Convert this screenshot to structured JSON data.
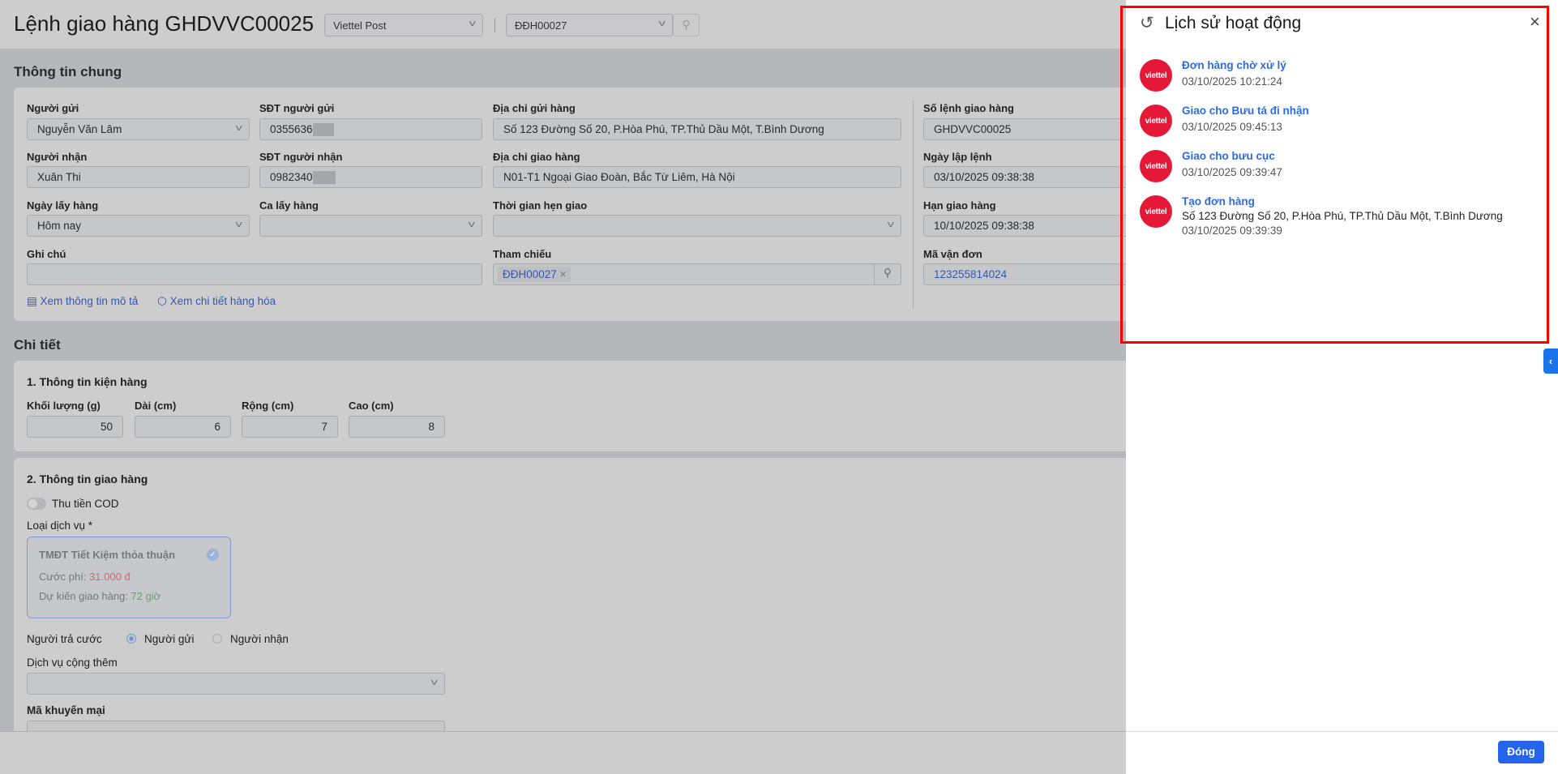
{
  "header": {
    "title": "Lệnh giao hàng GHDVVC00025",
    "carrier": "Viettel Post",
    "order": "ĐĐH00027"
  },
  "general": {
    "section_title": "Thông tin chung",
    "sender_label": "Người gửi",
    "sender": "Nguyễn Văn Lâm",
    "sender_phone_label": "SĐT người gửi",
    "sender_phone": "0355636",
    "pickup_addr_label": "Địa chỉ gửi hàng",
    "pickup_addr": "Số 123 Đường Số 20, P.Hòa Phú, TP.Thủ Dầu Một, T.Bình Dương",
    "receiver_label": "Người nhận",
    "receiver": "Xuân Thi",
    "receiver_phone_label": "SĐT người nhận",
    "receiver_phone": "0982340",
    "delivery_addr_label": "Địa chỉ giao hàng",
    "delivery_addr": "N01-T1 Ngoại Giao Đoàn, Bắc Từ Liêm, Hà Nội",
    "pickup_date_label": "Ngày lấy hàng",
    "pickup_date": "Hôm nay",
    "pickup_shift_label": "Ca lấy hàng",
    "appointment_label": "Thời gian hẹn giao",
    "note_label": "Ghi chú",
    "reference_label": "Tham chiếu",
    "reference_tag": "ĐĐH00027",
    "link_description": "Xem thông tin mô tả",
    "link_goods": "Xem chi tiết hàng hóa",
    "order_no_label": "Số lệnh giao hàng",
    "order_no": "GHDVVC00025",
    "created_label": "Ngày lập lệnh",
    "created": "03/10/2025 09:38:38",
    "deadline_label": "Hạn giao hàng",
    "deadline": "10/10/2025 09:38:38",
    "tracking_label": "Mã vận đơn",
    "tracking": "123255814024"
  },
  "detail": {
    "section_title": "Chi tiết",
    "package_title": "1. Thông tin kiện hàng",
    "weight_label": "Khối lượng (g)",
    "weight": "50",
    "length_label": "Dài (cm)",
    "length": "6",
    "width_label": "Rộng (cm)",
    "width": "7",
    "height_label": "Cao (cm)",
    "height": "8",
    "delivery_title": "2. Thông tin giao hàng",
    "cod_label": "Thu tiền COD",
    "service_label": "Loại dịch vụ *",
    "service_name": "TMĐT Tiết Kiệm thỏa thuận",
    "fee_label": "Cước phí: ",
    "fee": "31.000 đ",
    "eta_label": "Dự kiến giao hàng: ",
    "eta": "72 giờ",
    "payer_label": "Người trả cước",
    "payer_sender": "Người gửi",
    "payer_receiver": "Người nhận",
    "extra_label": "Dịch vụ cộng thêm",
    "promo_label": "Mã khuyến mại"
  },
  "history": {
    "title": "Lịch sử hoạt động",
    "avatar_text": "viettel",
    "items": [
      {
        "title": "Đơn hàng chờ xử lý",
        "time": "03/10/2025 10:21:24"
      },
      {
        "title": "Giao cho Bưu tá đi nhận",
        "time": "03/10/2025 09:45:13"
      },
      {
        "title": "Giao cho bưu cục",
        "time": "03/10/2025 09:39:47"
      },
      {
        "title": "Tạo đơn hàng",
        "address": "Số 123 Đường Số 20, P.Hòa Phú, TP.Thủ Dầu Một, T.Bình Dương",
        "time": "03/10/2025 09:39:39"
      }
    ],
    "close_button": "Đóng"
  },
  "colors": {
    "accent": "#2f6be0",
    "highlight": "#ff0000",
    "brand": "#e51937"
  }
}
